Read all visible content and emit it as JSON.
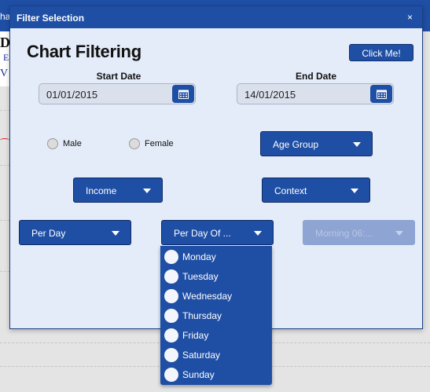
{
  "background_app": {
    "tab_fragment": "ha",
    "letter_1": "D",
    "letter_2": "E",
    "letter_3": "V"
  },
  "dialog": {
    "title": "Filter Selection",
    "close_symbol": "×",
    "heading": "Chart Filtering",
    "click_button": "Click Me!",
    "start_date": {
      "label": "Start Date",
      "value": "01/01/2015"
    },
    "end_date": {
      "label": "End Date",
      "value": "14/01/2015"
    },
    "gender": {
      "options": [
        "Male",
        "Female"
      ]
    },
    "dropdowns": {
      "age_group": "Age Group",
      "income": "Income",
      "context": "Context",
      "per_day": "Per Day",
      "per_day_of": "Per Day Of ...",
      "time_slot": "Morning 06:..."
    },
    "weekday_menu": [
      "Monday",
      "Tuesday",
      "Wednesday",
      "Thursday",
      "Friday",
      "Saturday",
      "Sunday"
    ]
  },
  "colors": {
    "primary": "#1f4fa5",
    "dialog_bg": "#e4ecf9",
    "disabled": "#8ea4d3"
  },
  "icons": {
    "calendar": "calendar-icon",
    "caret": "chevron-down-icon"
  }
}
